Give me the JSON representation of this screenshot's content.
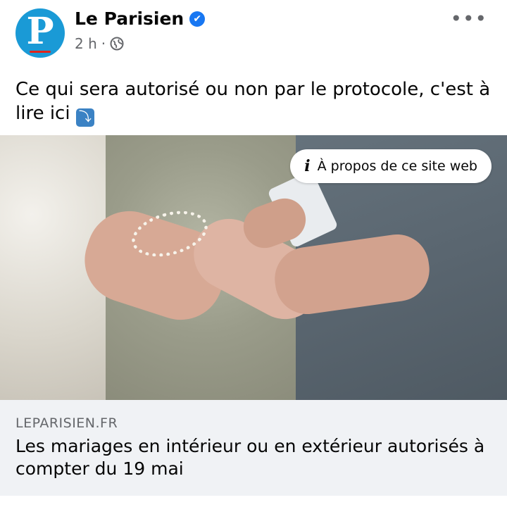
{
  "header": {
    "avatar_letter": "P",
    "page_name": "Le Parisien",
    "verified_icon": "✔",
    "time": "2 h",
    "separator": "·",
    "audience_icon": "globe-icon",
    "more_label": "•••"
  },
  "post": {
    "text": "Ce qui sera autorisé ou non par le protocole, c'est à lire ici",
    "emoji": "⤵"
  },
  "photo": {
    "about_label": "À propos de ce site web",
    "about_icon": "i"
  },
  "link": {
    "domain": "LEPARISIEN.FR",
    "title": "Les mariages en intérieur ou en extérieur autorisés à compter du 19 mai"
  },
  "colors": {
    "brand_blue": "#1a9ad6",
    "verified_blue": "#1877f2",
    "link_bg": "#f0f2f5",
    "muted_text": "#65676b"
  }
}
